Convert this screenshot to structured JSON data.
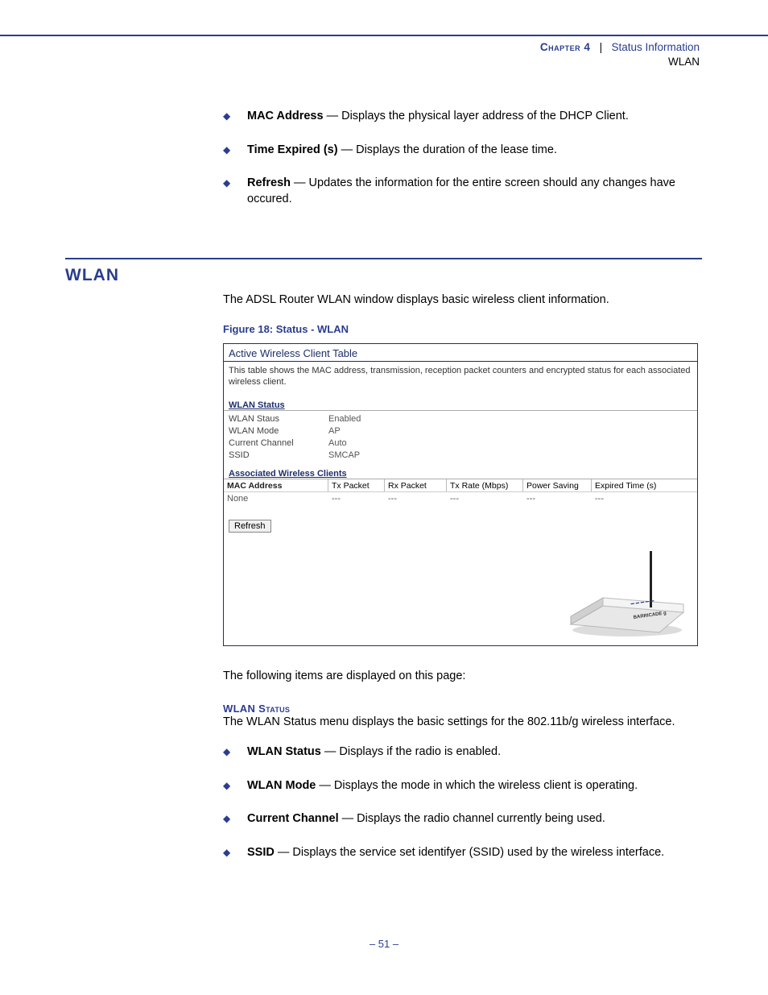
{
  "header": {
    "chapter": "Chapter 4",
    "separator": "|",
    "title": "Status Information",
    "subtitle": "WLAN"
  },
  "top_bullets": [
    {
      "term": "MAC Address",
      "desc": " — Displays the physical layer address of the DHCP Client."
    },
    {
      "term": "Time Expired (s)",
      "desc": " — Displays the duration of the lease time."
    },
    {
      "term": "Refresh",
      "desc": " — Updates the information for the entire screen should any changes have occured."
    }
  ],
  "section_heading": "WLAN",
  "section_intro": "The ADSL Router WLAN window displays basic wireless client information.",
  "figure_caption": "Figure 18:  Status - WLAN",
  "panel": {
    "title": "Active Wireless Client Table",
    "description": "This table shows the MAC address, transmission, reception packet counters and encrypted status for each associated wireless client.",
    "status_heading": "WLAN Status",
    "status_rows": [
      {
        "k": "WLAN Staus",
        "v": "Enabled"
      },
      {
        "k": "WLAN Mode",
        "v": "AP"
      },
      {
        "k": "Current Channel",
        "v": "Auto"
      },
      {
        "k": "SSID",
        "v": "SMCAP"
      }
    ],
    "clients_heading": "Associated Wireless Clients",
    "client_columns": [
      "MAC Address",
      "Tx Packet",
      "Rx Packet",
      "Tx Rate (Mbps)",
      "Power Saving",
      "Expired Time (s)"
    ],
    "client_row": {
      "mac": "None",
      "tx": "---",
      "rx": "---",
      "rate": "---",
      "ps": "---",
      "et": "---"
    },
    "refresh_label": "Refresh"
  },
  "after_panel_intro": "The following items are displayed on this page:",
  "wlan_status_head": "WLAN Status",
  "wlan_status_desc": "The WLAN Status menu displays the basic settings for the 802.11b/g wireless interface.",
  "lower_bullets": [
    {
      "term": "WLAN Status",
      "desc": " — Displays if the radio is enabled."
    },
    {
      "term": "WLAN Mode",
      "desc": " — Displays the mode in which the wireless client is operating."
    },
    {
      "term": "Current Channel",
      "desc": " — Displays the radio channel currently being used."
    },
    {
      "term": "SSID",
      "desc": " — Displays the service set identifyer (SSID) used by the wireless interface."
    }
  ],
  "page_number": "–  51  –"
}
